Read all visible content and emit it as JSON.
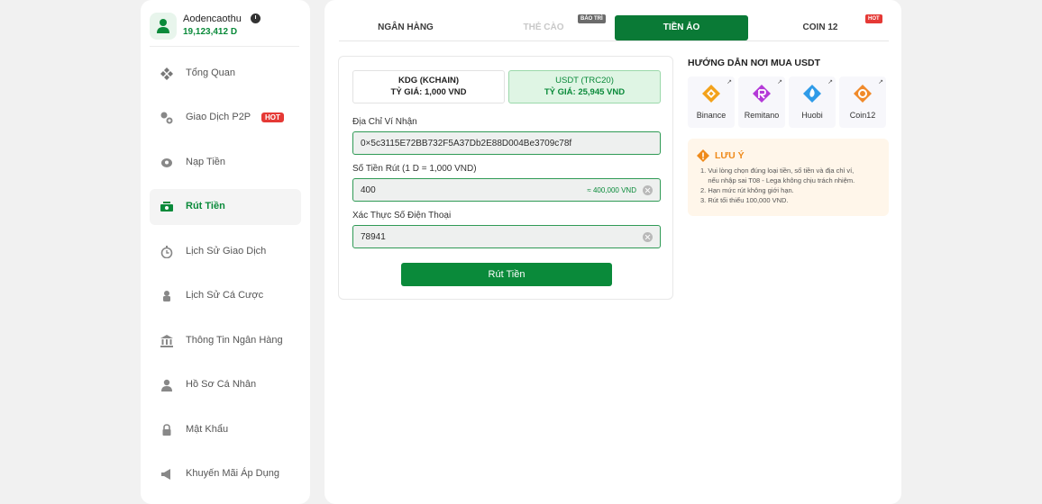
{
  "user": {
    "name": "Aodencaothu",
    "balance": "19,123,412 D"
  },
  "sidebar": {
    "items": [
      {
        "label": "Tổng Quan"
      },
      {
        "label": "Giao Dịch P2P",
        "badge": "HOT"
      },
      {
        "label": "Nạp Tiền"
      },
      {
        "label": "Rút Tiền",
        "active": true
      },
      {
        "label": "Lịch Sử Giao Dịch"
      },
      {
        "label": "Lịch Sử Cá Cược"
      },
      {
        "label": "Thông Tin Ngân Hàng"
      },
      {
        "label": "Hồ Sơ Cá Nhân"
      },
      {
        "label": "Mật Khẩu"
      },
      {
        "label": "Khuyến Mãi Áp Dụng"
      }
    ]
  },
  "tabs": [
    {
      "label": "NGÂN HÀNG"
    },
    {
      "label": "THẺ CÀO",
      "badge": "BẢO TRÌ",
      "disabled": true
    },
    {
      "label": "TIỀN ẢO",
      "active": true
    },
    {
      "label": "COIN 12",
      "badge": "HOT"
    }
  ],
  "coins": [
    {
      "name": "KDG (KCHAIN)",
      "rate": "TỶ GIÁ: 1,000 VND"
    },
    {
      "name": "USDT (TRC20)",
      "rate": "TỶ GIÁ: 25,945 VND",
      "selected": true
    }
  ],
  "form": {
    "wallet_label": "Địa Chỉ Ví Nhận",
    "wallet_value": "0×5c3115E72BB732F5A37Db2E88D004Be3709c78f",
    "amount_label": "Số Tiền Rút (1 D = 1,000 VND)",
    "amount_value": "400",
    "amount_hint": "≈ 400,000 VND",
    "phone_label": "Xác Thực Số Điện Thoại",
    "phone_value": "78941",
    "submit_label": "Rút Tiền"
  },
  "guide": {
    "title": "HƯỚNG DẪN NƠI MUA USDT",
    "exchanges": [
      {
        "name": "Binance",
        "color": "#f3a21b"
      },
      {
        "name": "Remitano",
        "color": "#b43ad8"
      },
      {
        "name": "Huobi",
        "color": "#2f9be8"
      },
      {
        "name": "Coin12",
        "color": "#f08a2a"
      }
    ]
  },
  "note": {
    "title": "LƯU Ý",
    "items": [
      "1. Vui lòng chọn đúng loại tiền, số tiền và địa chỉ ví,",
      "    nếu nhập sai T08 - Lega không chịu trách nhiệm.",
      "2. Hạn mức rút không giới hạn.",
      "3. Rút tối thiểu 100,000 VND."
    ]
  },
  "colors": {
    "brand_green": "#0a8a3a",
    "active_tab": "#0a7a36",
    "hot_red": "#e53935",
    "note_orange": "#ef8a1a"
  }
}
